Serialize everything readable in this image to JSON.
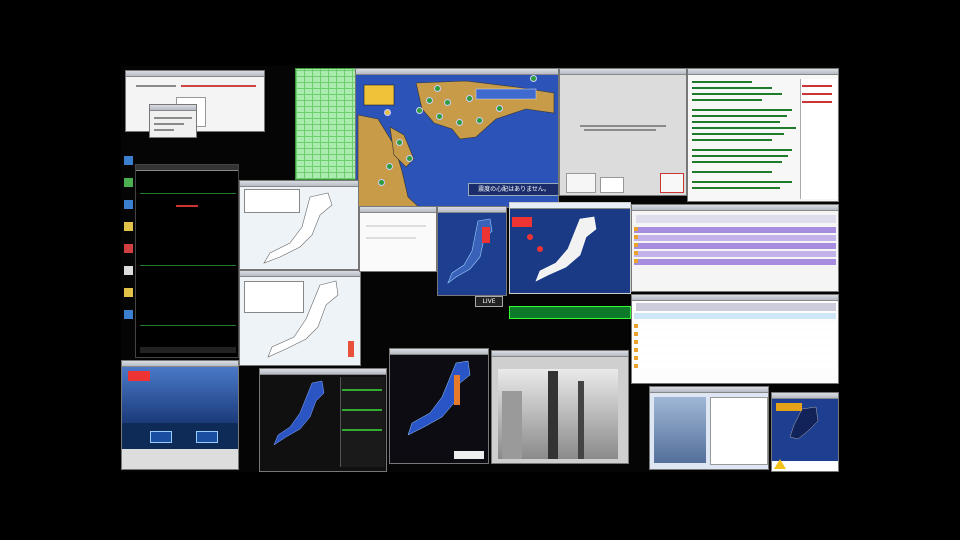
{
  "quake_map": {
    "caption": "震度の心配はありません。"
  },
  "live_label": "LIVE",
  "colors": {
    "background": "#000000",
    "sea": "#2c53b8",
    "land": "#c79b47",
    "seismic_blue": "#1e3f8f",
    "alert_green": "#0c7a28",
    "purple_rows": "#a78de0"
  },
  "icons": [
    "warning-icon",
    "desktop-icons"
  ]
}
